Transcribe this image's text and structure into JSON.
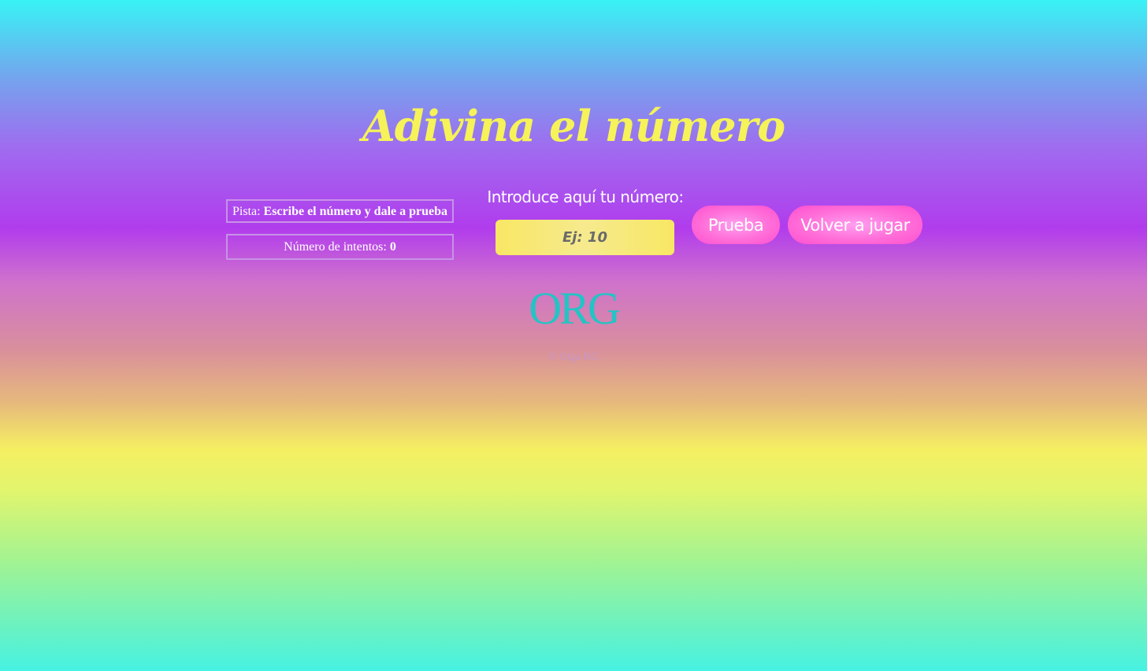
{
  "header": {
    "title": "Adivina el número"
  },
  "status": {
    "hint_label": "Pista: ",
    "hint_value": "Escribe el número y dale a prueba",
    "attempts_label": "Número de intentos: ",
    "attempts_value": "0"
  },
  "form": {
    "input_label": "Introduce aquí tu número:",
    "input_placeholder": "Ej: 10",
    "input_value": "",
    "try_button": "Prueba",
    "replay_button": "Volver a jugar"
  },
  "footer": {
    "logo_text": "ORG",
    "copyright": "© Olga RG"
  },
  "colors": {
    "title": "#f6f25a",
    "button": "#ff6ed8",
    "input_bg": "#f8e764",
    "logo": "#22c4c4"
  }
}
